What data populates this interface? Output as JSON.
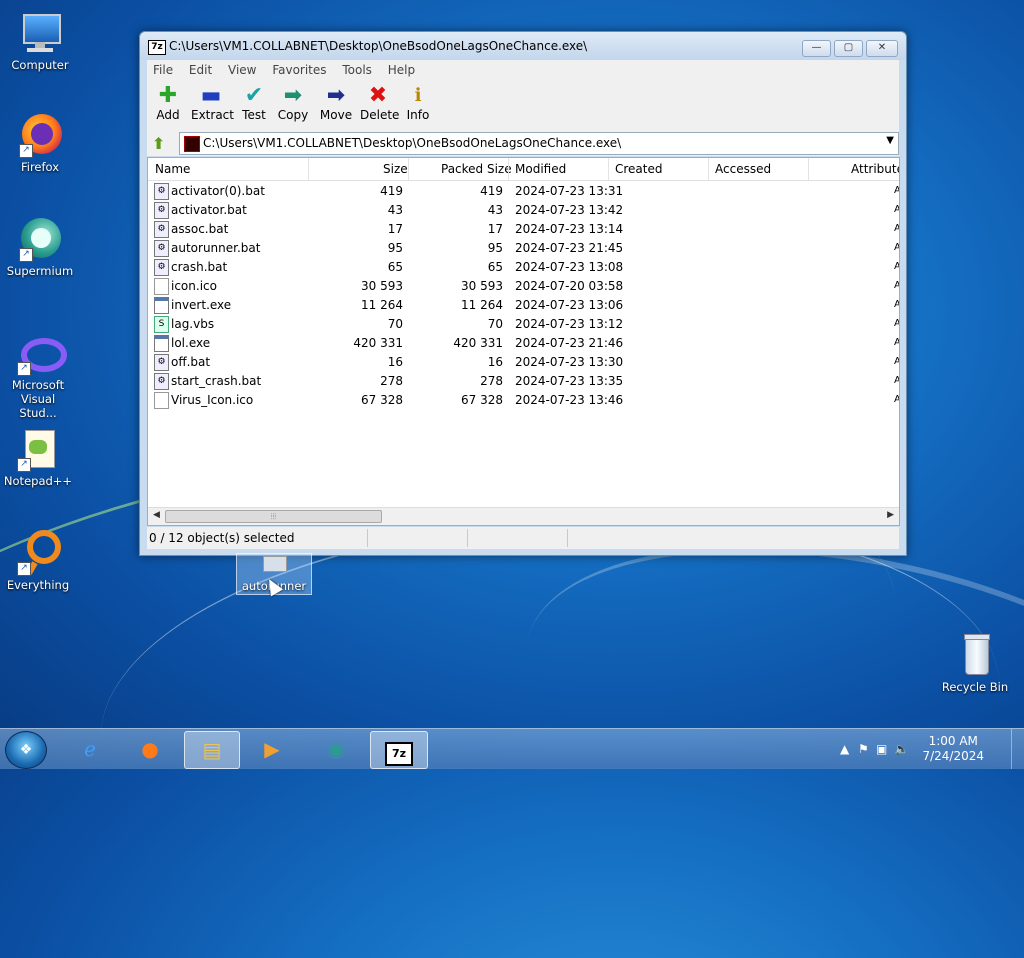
{
  "desktop": {
    "icons": [
      {
        "label": "Computer"
      },
      {
        "label": "Firefox"
      },
      {
        "label": "Supermium"
      },
      {
        "label": "Microsoft Visual Stud..."
      },
      {
        "label": "Notepad++"
      },
      {
        "label": "Everything"
      },
      {
        "label": "Recycle Bin"
      }
    ],
    "dragged_item": {
      "label": "autorunner"
    }
  },
  "window": {
    "title": "C:\\Users\\VM1.COLLABNET\\Desktop\\OneBsodOneLagsOneChance.exe\\",
    "title_icon": "7z",
    "caption": {
      "minimize": "—",
      "maximize": "▢",
      "close": "✕"
    },
    "menu": [
      "File",
      "Edit",
      "View",
      "Favorites",
      "Tools",
      "Help"
    ],
    "toolbar": {
      "add": "Add",
      "extract": "Extract",
      "test": "Test",
      "copy": "Copy",
      "move": "Move",
      "delete": "Delete",
      "info": "Info"
    },
    "address": "C:\\Users\\VM1.COLLABNET\\Desktop\\OneBsodOneLagsOneChance.exe\\",
    "columns": {
      "name": "Name",
      "size": "Size",
      "packed": "Packed Size",
      "modified": "Modified",
      "created": "Created",
      "accessed": "Accessed",
      "attributes": "Attribute"
    },
    "files": [
      {
        "name": "activator(0).bat",
        "size": "419",
        "packed": "419",
        "modified": "2024-07-23 13:31",
        "type": "bat"
      },
      {
        "name": "activator.bat",
        "size": "43",
        "packed": "43",
        "modified": "2024-07-23 13:42",
        "type": "bat"
      },
      {
        "name": "assoc.bat",
        "size": "17",
        "packed": "17",
        "modified": "2024-07-23 13:14",
        "type": "bat"
      },
      {
        "name": "autorunner.bat",
        "size": "95",
        "packed": "95",
        "modified": "2024-07-23 21:45",
        "type": "bat"
      },
      {
        "name": "crash.bat",
        "size": "65",
        "packed": "65",
        "modified": "2024-07-23 13:08",
        "type": "bat"
      },
      {
        "name": "icon.ico",
        "size": "30 593",
        "packed": "30 593",
        "modified": "2024-07-20 03:58",
        "type": "ico"
      },
      {
        "name": "invert.exe",
        "size": "11 264",
        "packed": "11 264",
        "modified": "2024-07-23 13:06",
        "type": "exe"
      },
      {
        "name": "lag.vbs",
        "size": "70",
        "packed": "70",
        "modified": "2024-07-23 13:12",
        "type": "vbs"
      },
      {
        "name": "lol.exe",
        "size": "420 331",
        "packed": "420 331",
        "modified": "2024-07-23 21:46",
        "type": "exe"
      },
      {
        "name": "off.bat",
        "size": "16",
        "packed": "16",
        "modified": "2024-07-23 13:30",
        "type": "bat"
      },
      {
        "name": "start_crash.bat",
        "size": "278",
        "packed": "278",
        "modified": "2024-07-23 13:35",
        "type": "bat"
      },
      {
        "name": "Virus_Icon.ico",
        "size": "67 328",
        "packed": "67 328",
        "modified": "2024-07-23 13:46",
        "type": "ico"
      }
    ],
    "status": "0 / 12 object(s) selected"
  },
  "taskbar": {
    "clock_time": "1:00 AM",
    "clock_date": "7/24/2024"
  }
}
